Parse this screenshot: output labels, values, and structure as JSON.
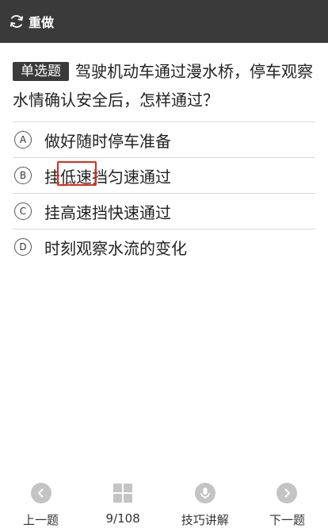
{
  "header": {
    "redo_label": "重做"
  },
  "question": {
    "type_label": "单选题",
    "text": "驾驶机动车通过漫水桥，停车观察水情确认安全后，怎样通过？"
  },
  "options": [
    {
      "letter": "A",
      "text": "做好随时停车准备"
    },
    {
      "letter": "B",
      "text": "挂低速挡匀速通过"
    },
    {
      "letter": "C",
      "text": "挂高速挡快速通过"
    },
    {
      "letter": "D",
      "text": "时刻观察水流的变化"
    }
  ],
  "highlight": {
    "color": "#e02a1a"
  },
  "bottom_nav": {
    "prev_label": "上一题",
    "progress": "9/108",
    "tips_label": "技巧讲解",
    "next_label": "下一题"
  },
  "colors": {
    "header_bg": "#3a3a3a",
    "icon_gray": "#c4c4c4"
  }
}
